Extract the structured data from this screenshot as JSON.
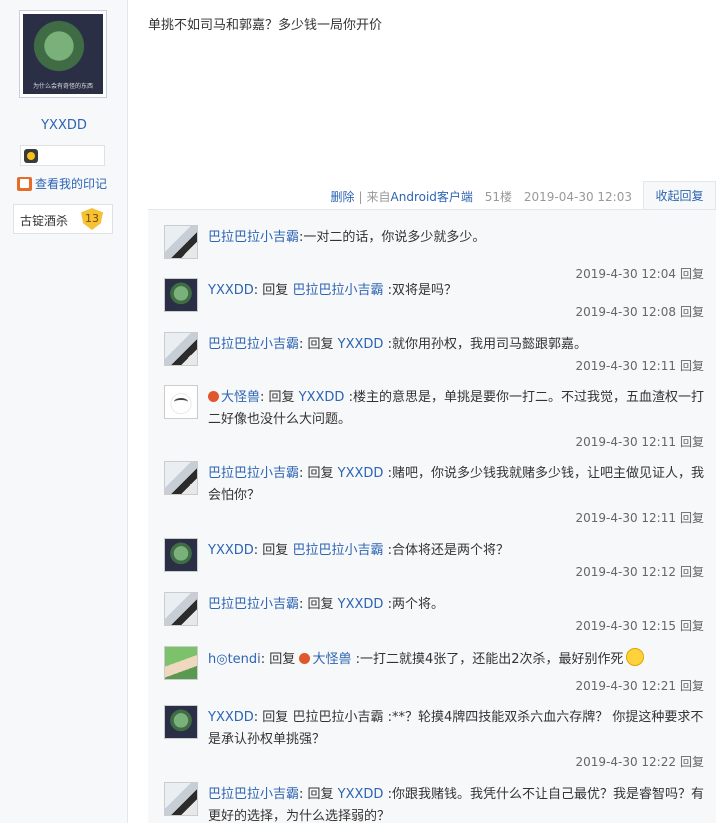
{
  "left": {
    "username": "YXXDD",
    "mark_link": "查看我的印记",
    "level_name": "古锭酒杀",
    "level_num": "13",
    "avatar_caption": "为什么会有奇怪的东西"
  },
  "post": {
    "text": "单挑不如司马和郭嘉？多少钱一局你开价",
    "delete": "删除",
    "sep": "|",
    "source_prefix": "来自",
    "source_link": "Android客户端",
    "floor": "51楼",
    "time": "2019-04-30 12:03",
    "toggle": "收起回复"
  },
  "comments": [
    {
      "author": "巴拉巴拉小吉霸",
      "text": ":一对二的话，你说多少就多少。",
      "time": "2019-4-30 12:04",
      "reply": "回复"
    },
    {
      "author": "YXXDD",
      "pre": ": 回复 ",
      "target": "巴拉巴拉小吉霸",
      "text": " :双将是吗？",
      "time": "2019-4-30 12:08",
      "reply": "回复"
    },
    {
      "author": "巴拉巴拉小吉霸",
      "pre": ": 回复 ",
      "target": "YXXDD",
      "text": " :就你用孙权，我用司马懿跟郭嘉。",
      "time": "2019-4-30 12:11",
      "reply": "回复"
    },
    {
      "author": "大怪兽",
      "pre": ": 回复 ",
      "target": "YXXDD",
      "text": " :楼主的意思是，单挑是要你一打二。不过我觉，五血渣权一打二好像也没什么大问题。",
      "time": "2019-4-30 12:11",
      "reply": "回复"
    },
    {
      "author": "巴拉巴拉小吉霸",
      "pre": ": 回复 ",
      "target": "YXXDD",
      "text": " :赌吧，你说多少钱我就赌多少钱，让吧主做见证人，我会怕你？",
      "time": "2019-4-30 12:11",
      "reply": "回复"
    },
    {
      "author": "YXXDD",
      "pre": ": 回复 ",
      "target": "巴拉巴拉小吉霸",
      "text": " :合体将还是两个将？",
      "time": "2019-4-30 12:12",
      "reply": "回复"
    },
    {
      "author": "巴拉巴拉小吉霸",
      "pre": ": 回复 ",
      "target": "YXXDD",
      "text": " :两个将。",
      "time": "2019-4-30 12:15",
      "reply": "回复"
    },
    {
      "author": "h◎tendi",
      "pre": ": 回复 ",
      "target": "大怪兽",
      "text": " :一打二就摸4张了，还能出2次杀，最好别作死",
      "time": "2019-4-30 12:21",
      "reply": "回复"
    },
    {
      "author": "YXXDD",
      "pre": ": 回复 ",
      "target": "巴拉巴拉小吉霸",
      "text": " :**？轮摸4牌四技能双杀六血六存牌？ 你提这种要求不是承认孙权单挑强？",
      "time": "2019-4-30 12:22",
      "reply": "回复"
    },
    {
      "author": "巴拉巴拉小吉霸",
      "pre": ": 回复 ",
      "target": "YXXDD",
      "text": " :你跟我赌钱。我凭什么不让自己最优？我是睿智吗？有更好的选择，为什么选择弱的？",
      "time": "",
      "reply": ""
    }
  ]
}
